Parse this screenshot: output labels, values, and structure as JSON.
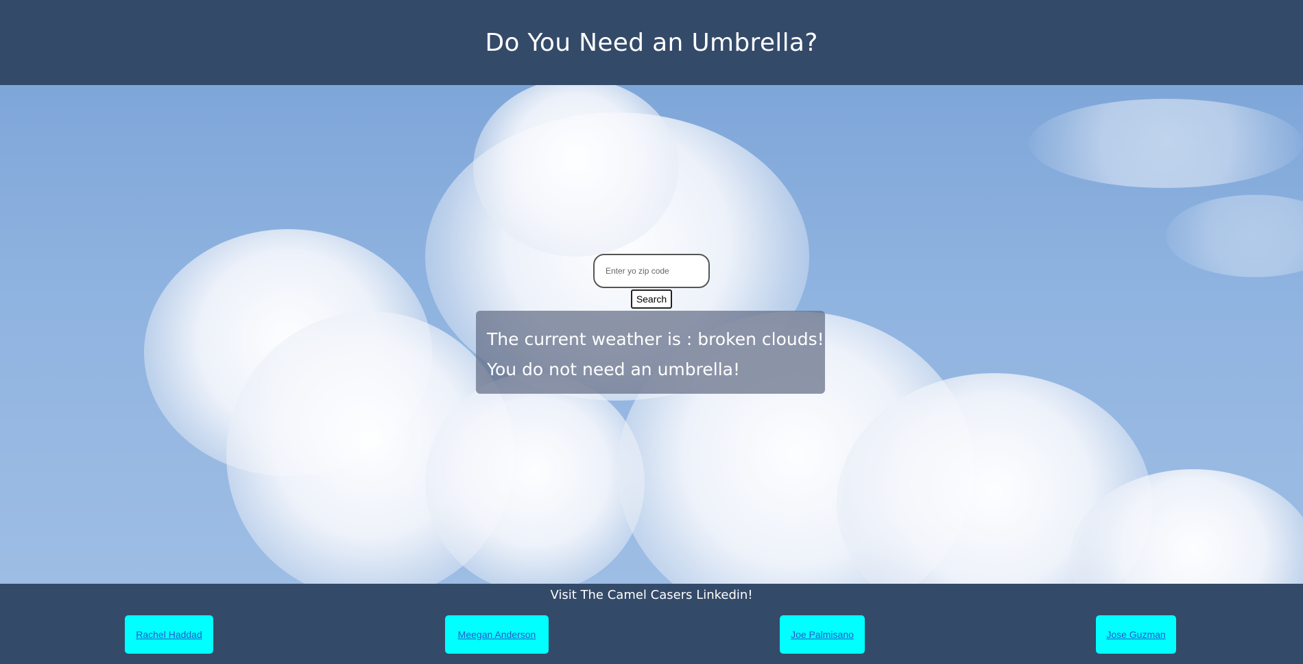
{
  "header": {
    "title": "Do You Need an Umbrella?"
  },
  "search": {
    "placeholder": "Enter yo zip code",
    "button_label": "Search"
  },
  "result": {
    "weather_line": "The current weather is : broken clouds!",
    "umbrella_line": "You do not need an umbrella!"
  },
  "footer": {
    "title": "Visit The Camel Casers Linkedin!",
    "links": [
      {
        "label": "Rachel Haddad"
      },
      {
        "label": "Meegan Anderson"
      },
      {
        "label": "Joe Palmisano"
      },
      {
        "label": "Jose Guzman"
      }
    ]
  },
  "colors": {
    "header_bg": "#344a69",
    "link_bg": "#00ffff",
    "link_text": "#2659c9"
  },
  "icons": {
    "background": "sky-clouds-image"
  }
}
